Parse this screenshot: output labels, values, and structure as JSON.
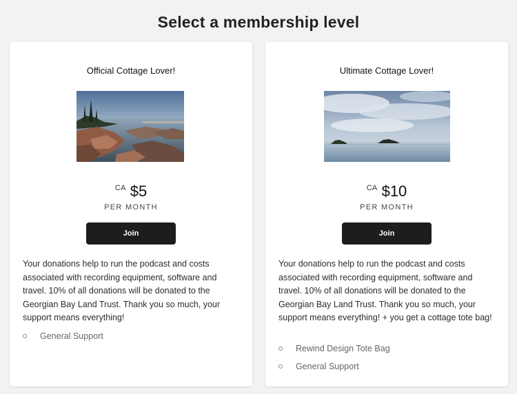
{
  "page": {
    "title": "Select a membership level"
  },
  "tiers": [
    {
      "name": "Official Cottage Lover!",
      "currency": "CA",
      "price": "$5",
      "period": "PER MONTH",
      "join_label": "Join",
      "description": "Your donations help to run the podcast and costs associated with recording equipment, software and travel. 10% of all donations will be donated to the Georgian Bay Land Trust. Thank you so much, your support means everything!",
      "benefits": [
        "General Support"
      ]
    },
    {
      "name": "Ultimate Cottage Lover!",
      "currency": "CA",
      "price": "$10",
      "period": "PER MONTH",
      "join_label": "Join",
      "description": "Your donations help to run the podcast and costs associated with recording equipment, software and travel. 10% of all donations will be donated to the Georgian Bay Land Trust. Thank you so much, your support means everything! + you get a cottage tote bag!",
      "benefits": [
        "Rewind Design Tote Bag",
        "General Support"
      ]
    }
  ],
  "colors": {
    "page_background": "#f2f2f2",
    "card_background": "#ffffff",
    "button_background": "#1d1d1d",
    "button_text": "#ffffff"
  }
}
